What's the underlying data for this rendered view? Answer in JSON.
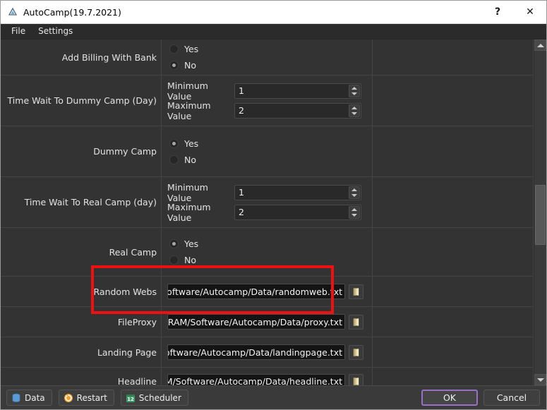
{
  "window": {
    "title": "AutoCamp(19.7.2021)",
    "icon": "app-icon",
    "help_label": "?",
    "close_label": "✕"
  },
  "menubar": {
    "items": [
      {
        "label": "File"
      },
      {
        "label": "Settings"
      }
    ]
  },
  "settings": {
    "rows": [
      {
        "label": "Add Billing With Bank",
        "type": "radio",
        "options": [
          {
            "label": "Yes",
            "selected": false
          },
          {
            "label": "No",
            "selected": true
          }
        ]
      },
      {
        "label": "Time Wait To Dummy Camp (Day)",
        "type": "spin",
        "fields": [
          {
            "label": "Minimum Value",
            "value": "1"
          },
          {
            "label": "Maximum Value",
            "value": "2"
          }
        ]
      },
      {
        "label": "Dummy Camp",
        "type": "radio",
        "options": [
          {
            "label": "Yes",
            "selected": true
          },
          {
            "label": "No",
            "selected": false
          }
        ]
      },
      {
        "label": "Time Wait To Real Camp (day)",
        "type": "spin",
        "fields": [
          {
            "label": "Minimum Value",
            "value": "1"
          },
          {
            "label": "Maximum Value",
            "value": "2"
          }
        ]
      },
      {
        "label": "Real Camp",
        "type": "radio",
        "highlighted": true,
        "options": [
          {
            "label": "Yes",
            "selected": true
          },
          {
            "label": "No",
            "selected": false
          }
        ]
      },
      {
        "label": "Random Webs",
        "type": "path",
        "value": "M/Software/Autocamp/Data/randomweb.txt",
        "browse_icon": "folder-icon"
      },
      {
        "label": "FileProxy",
        "type": "path",
        "value": ":/TRAM/Software/Autocamp/Data/proxy.txt",
        "browse_icon": "folder-icon"
      },
      {
        "label": "Landing Page",
        "type": "path",
        "value": "M/Software/Autocamp/Data/landingpage.txt",
        "browse_icon": "folder-icon"
      },
      {
        "label": "Headline",
        "type": "path",
        "value": "RAM/Software/Autocamp/Data/headline.txt",
        "browse_icon": "folder-icon"
      }
    ]
  },
  "annotation": {
    "color": "#ee1111",
    "target": "Real Camp"
  },
  "scrollbar": {
    "up_arrow": "scroll-up-icon",
    "down_arrow": "scroll-down-icon"
  },
  "bottombar": {
    "tools": [
      {
        "label": "Data",
        "icon": "database-icon"
      },
      {
        "label": "Restart",
        "icon": "refresh-icon"
      },
      {
        "label": "Scheduler",
        "icon": "calendar-icon",
        "icon_text": "12"
      }
    ],
    "ok_label": "OK",
    "cancel_label": "Cancel"
  }
}
